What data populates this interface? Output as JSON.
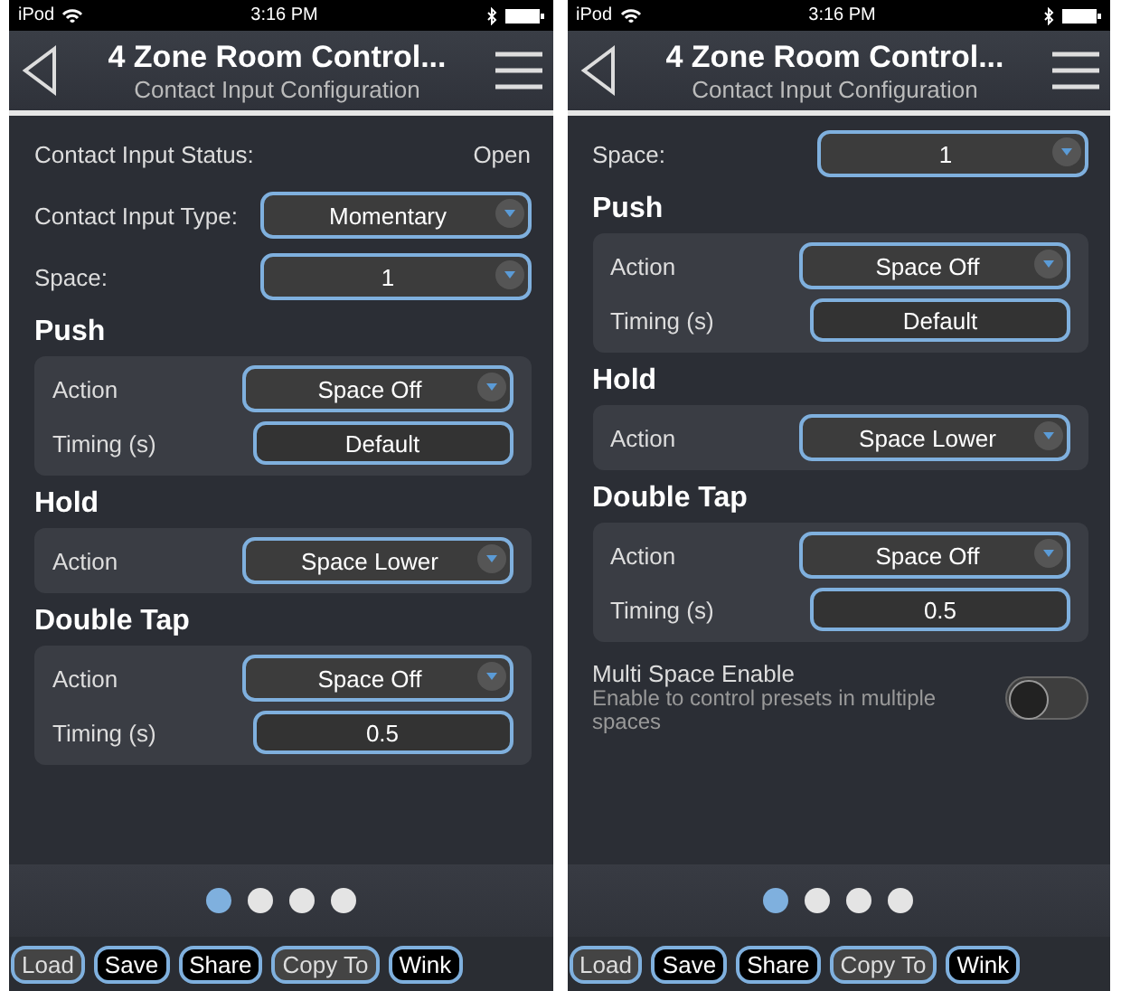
{
  "phones": [
    {
      "status_bar": {
        "carrier": "iPod",
        "time": "3:16 PM"
      },
      "header": {
        "title": "4 Zone Room Control...",
        "subtitle": "Contact Input Configuration"
      },
      "content": [
        {
          "kind": "info",
          "label": "Contact Input Status:",
          "value": "Open"
        },
        {
          "kind": "select",
          "label": "Contact Input Type:",
          "value": "Momentary"
        },
        {
          "kind": "select",
          "label": "Space:",
          "value": "1"
        },
        {
          "kind": "section",
          "title": "Push",
          "rows": [
            {
              "kind": "select",
              "label": "Action",
              "value": "Space Off"
            },
            {
              "kind": "field",
              "label": "Timing (s)",
              "value": "Default"
            }
          ]
        },
        {
          "kind": "section",
          "title": "Hold",
          "rows": [
            {
              "kind": "select",
              "label": "Action",
              "value": "Space Lower"
            }
          ]
        },
        {
          "kind": "section",
          "title": "Double Tap",
          "rows": [
            {
              "kind": "select",
              "label": "Action",
              "value": "Space Off"
            },
            {
              "kind": "field",
              "label": "Timing (s)",
              "value": "0.5"
            }
          ]
        }
      ],
      "pages": [
        {
          "selected": true
        },
        {
          "selected": false
        },
        {
          "selected": false
        },
        {
          "selected": false
        }
      ],
      "buttons": [
        {
          "label": "Load",
          "disabled": true
        },
        {
          "label": "Save",
          "disabled": false
        },
        {
          "label": "Share",
          "disabled": false
        },
        {
          "label": "Copy To",
          "disabled": true
        },
        {
          "label": "Wink",
          "disabled": false
        }
      ]
    },
    {
      "status_bar": {
        "carrier": "iPod",
        "time": "3:16 PM"
      },
      "header": {
        "title": "4 Zone Room Control...",
        "subtitle": "Contact Input Configuration"
      },
      "content": [
        {
          "kind": "select",
          "label": "Space:",
          "value": "1"
        },
        {
          "kind": "section",
          "title": "Push",
          "rows": [
            {
              "kind": "select",
              "label": "Action",
              "value": "Space Off"
            },
            {
              "kind": "field",
              "label": "Timing (s)",
              "value": "Default"
            }
          ]
        },
        {
          "kind": "section",
          "title": "Hold",
          "rows": [
            {
              "kind": "select",
              "label": "Action",
              "value": "Space Lower"
            }
          ]
        },
        {
          "kind": "section",
          "title": "Double Tap",
          "rows": [
            {
              "kind": "select",
              "label": "Action",
              "value": "Space Off"
            },
            {
              "kind": "field",
              "label": "Timing (s)",
              "value": "0.5"
            }
          ]
        },
        {
          "kind": "toggle",
          "label": "Multi Space Enable",
          "description": "Enable to control presets in multiple spaces",
          "on": false
        }
      ],
      "pages": [
        {
          "selected": true
        },
        {
          "selected": false
        },
        {
          "selected": false
        },
        {
          "selected": false
        }
      ],
      "buttons": [
        {
          "label": "Load",
          "disabled": true
        },
        {
          "label": "Save",
          "disabled": false
        },
        {
          "label": "Share",
          "disabled": false
        },
        {
          "label": "Copy To",
          "disabled": true
        },
        {
          "label": "Wink",
          "disabled": false
        }
      ]
    }
  ]
}
